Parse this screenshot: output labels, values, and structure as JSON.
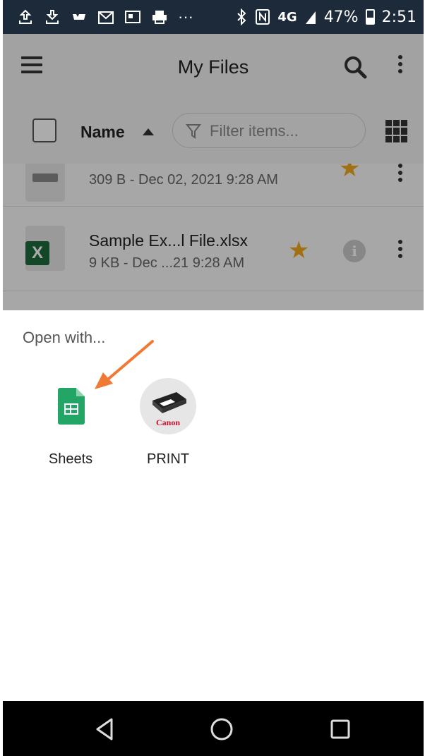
{
  "status_bar": {
    "icons": [
      "upload-icon",
      "download-icon",
      "nfl-icon",
      "gmail-icon",
      "news-icon",
      "print-icon",
      "more-icon"
    ],
    "more_label": "···",
    "network": "4G",
    "battery_percent": "47%",
    "battery_level": 0.47,
    "time": "2:51"
  },
  "app_bar": {
    "title": "My Files"
  },
  "toolbar": {
    "sort_label": "Name",
    "filter_placeholder": "Filter items..."
  },
  "files": [
    {
      "name": "",
      "meta": "309 B - Dec 02, 2021 9:28 AM",
      "starred": true
    },
    {
      "name": "Sample Ex...l File.xlsx",
      "meta": "9 KB - Dec ...21 9:28 AM",
      "starred": true,
      "icon_letter": "X"
    }
  ],
  "open_with": {
    "title": "Open with...",
    "apps": [
      {
        "label": "Sheets",
        "icon": "google-sheets-icon"
      },
      {
        "label": "PRINT",
        "icon": "canon-print-icon",
        "brand_text": "Canon"
      }
    ]
  },
  "colors": {
    "status_bar": "#1d2a3a",
    "sheets_green": "#23a566",
    "star": "#f1a81d",
    "arrow": "#f07a35",
    "excel_green": "#1d6b3c"
  }
}
